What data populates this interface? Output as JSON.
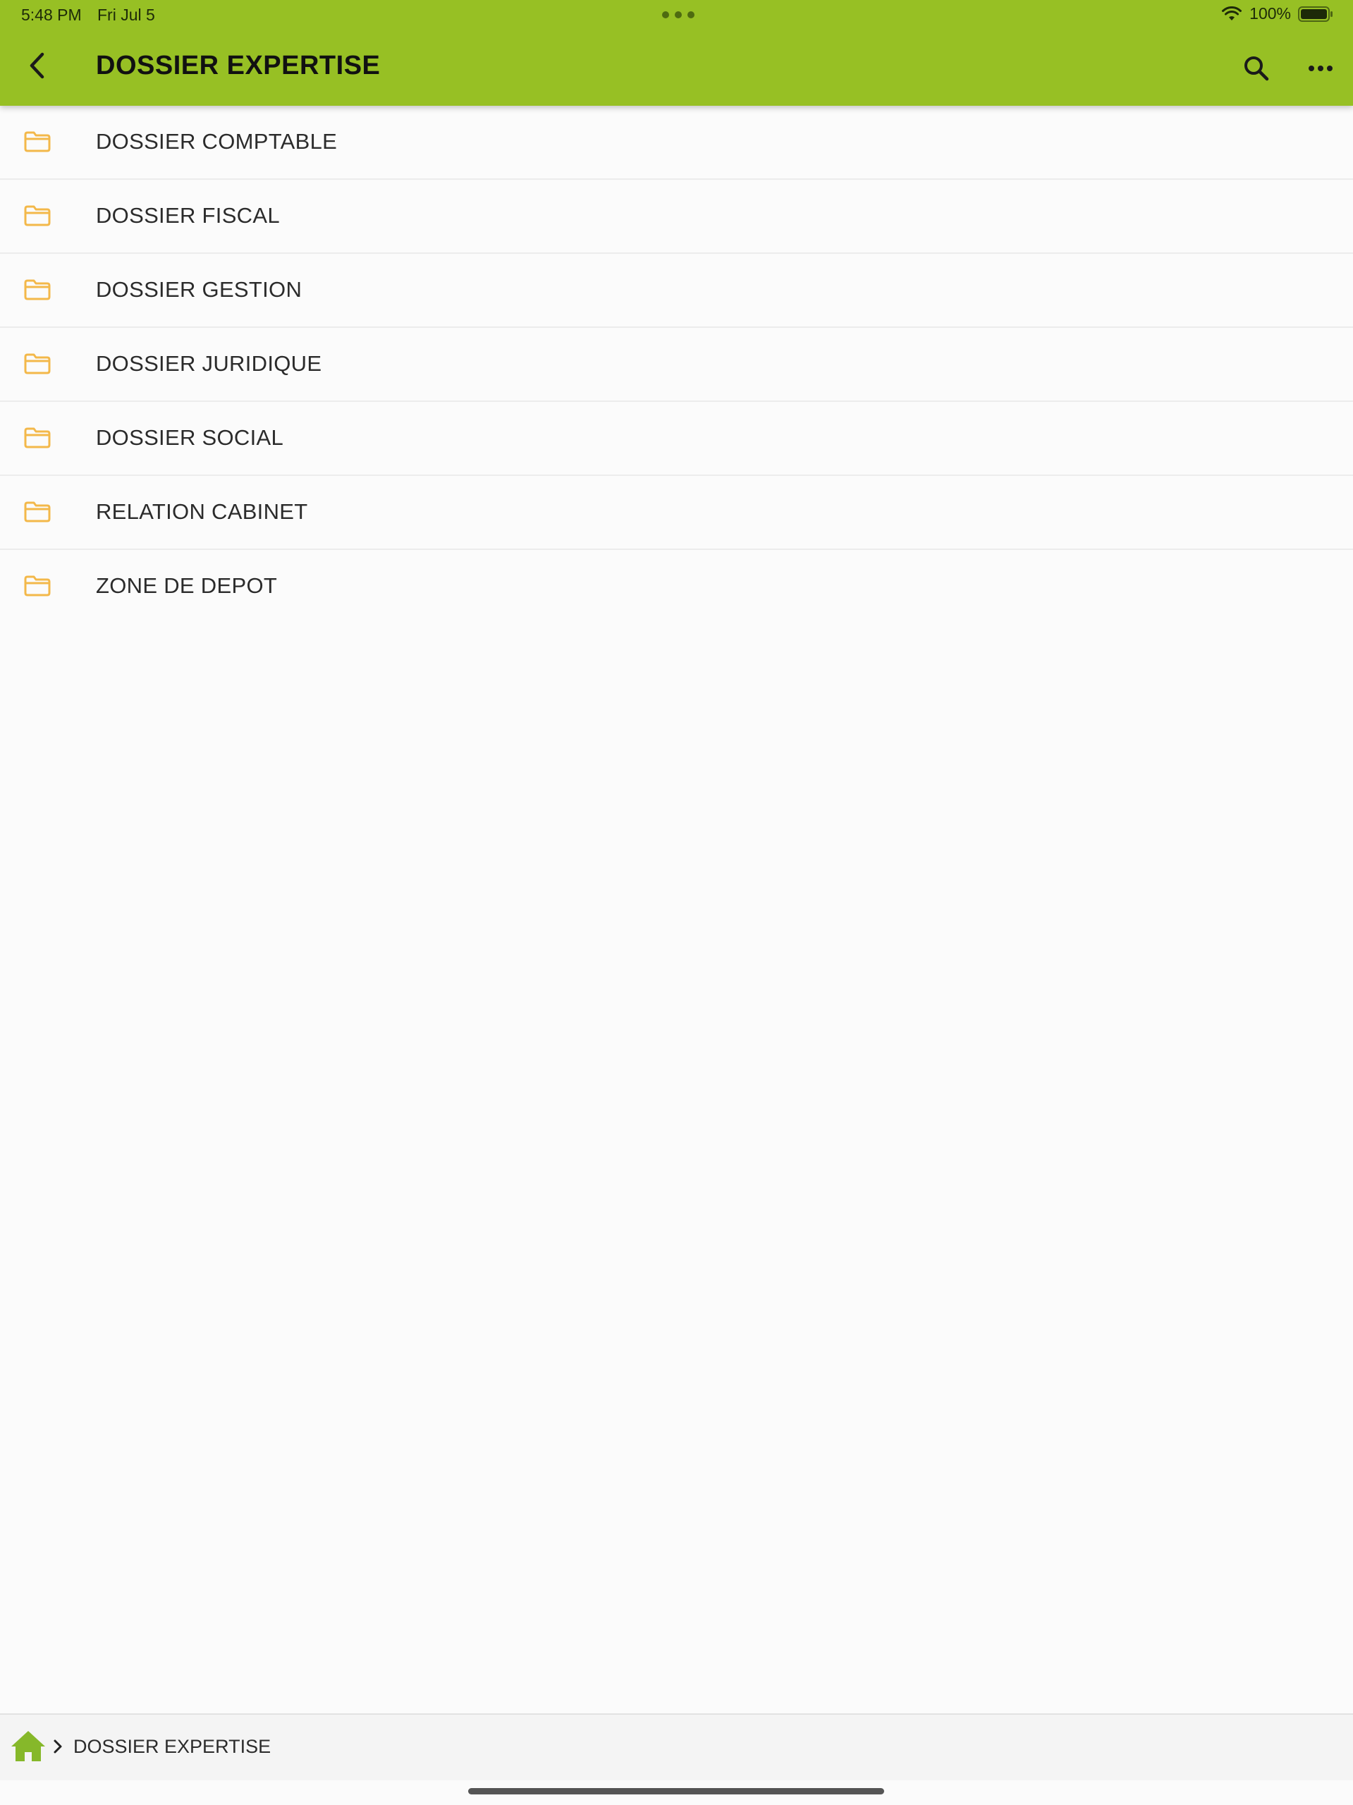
{
  "status_bar": {
    "time": "5:48 PM",
    "date": "Fri Jul 5",
    "battery": "100%"
  },
  "nav": {
    "title": "DOSSIER EXPERTISE"
  },
  "folders": [
    {
      "label": "DOSSIER COMPTABLE"
    },
    {
      "label": "DOSSIER FISCAL"
    },
    {
      "label": "DOSSIER GESTION"
    },
    {
      "label": "DOSSIER JURIDIQUE"
    },
    {
      "label": "DOSSIER SOCIAL"
    },
    {
      "label": "RELATION CABINET"
    },
    {
      "label": "ZONE DE DEPOT"
    }
  ],
  "breadcrumb": {
    "current": "DOSSIER EXPERTISE"
  },
  "colors": {
    "accent": "#97c024",
    "folder": "#f3b84a",
    "home": "#86b82a"
  },
  "icons": {
    "back": "chevron-left-icon",
    "search": "search-icon",
    "more": "more-horizontal-icon",
    "folder": "folder-icon",
    "home": "home-icon",
    "wifi": "wifi-icon",
    "battery": "battery-icon"
  }
}
